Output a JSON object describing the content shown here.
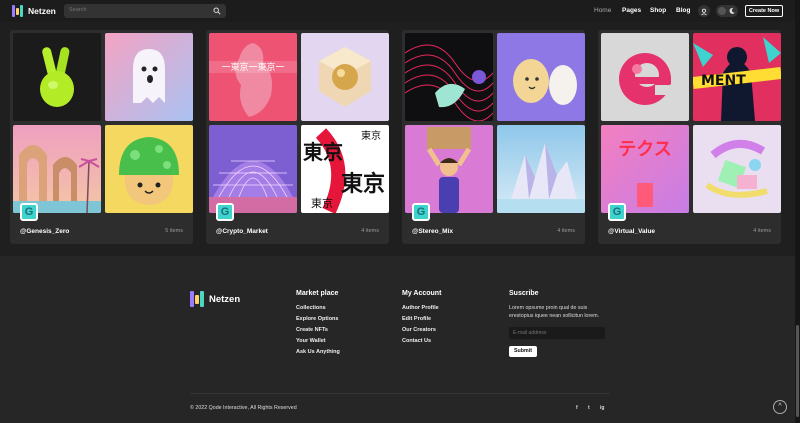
{
  "header": {
    "logo": "Netzen",
    "search_placeholder": "Search",
    "nav": [
      "Home",
      "Pages",
      "Shop",
      "Blog"
    ],
    "create_label": "Create Now",
    "icons": [
      "search-icon",
      "user-icon",
      "sun-icon",
      "moon-icon"
    ]
  },
  "collections": [
    {
      "name": "@Genesis_Zero",
      "count": "5 items",
      "avatar": "G"
    },
    {
      "name": "@Crypto_Market",
      "count": "4 items",
      "avatar": "G"
    },
    {
      "name": "@Stereo_Mix",
      "count": "4 items",
      "avatar": "G"
    },
    {
      "name": "@Virtual_Value",
      "count": "4 items",
      "avatar": "G"
    }
  ],
  "artwork_text": {
    "tokyo": "東京",
    "tokyo_banner": "一東京一東京一",
    "ment": "MENT",
    "texture": "テクス"
  },
  "footer": {
    "logo": "Netzen",
    "marketplace": {
      "title": "Market place",
      "links": [
        "Collections",
        "Explore Options",
        "Create NFTs",
        "Your Wallet",
        "Ask Us Anything"
      ]
    },
    "account": {
      "title": "My Account",
      "links": [
        "Author Profile",
        "Edit Profile",
        "Our Creators",
        "Contact Us"
      ]
    },
    "subscribe": {
      "title": "Suscribe",
      "text": "Lorem opsume proin qual de suis erestopius iquee nean sollicitun lorem.",
      "email_placeholder": "E-mail address",
      "submit_label": "Submit"
    },
    "copyright": "© 2022 Qode Interactive, All Rights Reserved",
    "social": [
      "f",
      "t",
      "ig"
    ]
  },
  "colors": {
    "background": "#1f1f1f",
    "card": "#2d2d2d",
    "avatar": "#3fd3d0",
    "accent_pink": "#e5326c"
  }
}
